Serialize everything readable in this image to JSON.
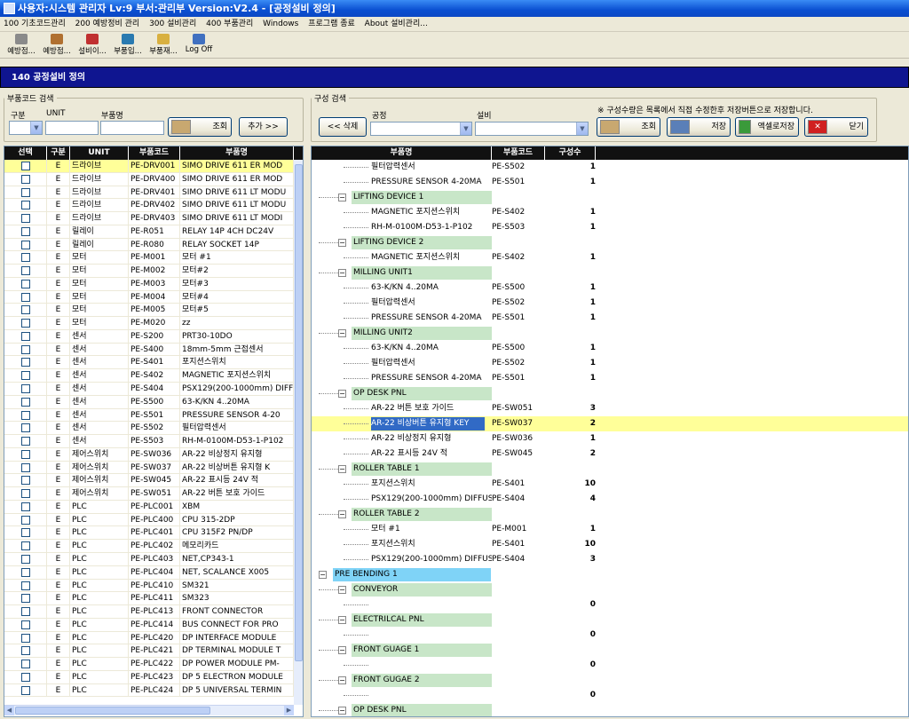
{
  "window": {
    "title": "사용자:시스템 관리자 Lv:9  부서:관리부  Version:V2.4 - [공정설비 정의]"
  },
  "menu": [
    "100 기초코드관리",
    "200 예방정비 관리",
    "300 설비관리",
    "400 부품관리",
    "Windows",
    "프로그램 종료",
    "About 설비관리..."
  ],
  "toolbar": [
    {
      "label": "예방점...",
      "icon": "wrench-icon",
      "color": "#8a8a8a"
    },
    {
      "label": "예방점...",
      "icon": "spray-icon",
      "color": "#b07030"
    },
    {
      "label": "설비이...",
      "icon": "pencil-icon",
      "color": "#c03030"
    },
    {
      "label": "부품입...",
      "icon": "door-in-icon",
      "color": "#2a7ab0"
    },
    {
      "label": "부품재...",
      "icon": "folder-icon",
      "color": "#d8b040"
    },
    {
      "label": "Log Off",
      "icon": "people-icon",
      "color": "#4070c0"
    }
  ],
  "form_title": "140 공정설비 정의",
  "part_search": {
    "legend": "부품코드 검색",
    "labels": [
      "구분",
      "UNIT",
      "부품명"
    ],
    "search_btn": "조회",
    "add_btn": "추가 >>"
  },
  "config_search": {
    "legend": "구성 검색",
    "labels": [
      "공정",
      "설비"
    ],
    "note": "※ 구성수량은 목록에서 직접 수정한후 저장버튼으로 저장합니다.",
    "delete_btn": "<< 삭제",
    "search_btn": "조회",
    "save_btn": "저장",
    "excel_btn": "액셀로저장",
    "close_btn": "닫기"
  },
  "left_grid": {
    "columns": [
      "선택",
      "구분",
      "UNIT",
      "부품코드",
      "부품명"
    ],
    "rows": [
      {
        "type": "E",
        "unit": "드라이브",
        "code": "PE-DRV001",
        "name": "SIMO DRIVE 611 ER MOD",
        "selected": true
      },
      {
        "type": "E",
        "unit": "드라이브",
        "code": "PE-DRV400",
        "name": "SIMO DRIVE 611 ER MOD"
      },
      {
        "type": "E",
        "unit": "드라이브",
        "code": "PE-DRV401",
        "name": "SIMO DRIVE 611 LT MODU"
      },
      {
        "type": "E",
        "unit": "드라이브",
        "code": "PE-DRV402",
        "name": "SIMO DRIVE 611 LT MODU"
      },
      {
        "type": "E",
        "unit": "드라이브",
        "code": "PE-DRV403",
        "name": "SIMO DRIVE 611 LT MODI"
      },
      {
        "type": "E",
        "unit": "릴레이",
        "code": "PE-R051",
        "name": "RELAY 14P 4CH DC24V"
      },
      {
        "type": "E",
        "unit": "릴레이",
        "code": "PE-R080",
        "name": "RELAY SOCKET 14P"
      },
      {
        "type": "E",
        "unit": "모터",
        "code": "PE-M001",
        "name": "모터 #1"
      },
      {
        "type": "E",
        "unit": "모터",
        "code": "PE-M002",
        "name": "모터#2"
      },
      {
        "type": "E",
        "unit": "모터",
        "code": "PE-M003",
        "name": "모터#3"
      },
      {
        "type": "E",
        "unit": "모터",
        "code": "PE-M004",
        "name": "모터#4"
      },
      {
        "type": "E",
        "unit": "모터",
        "code": "PE-M005",
        "name": "모터#5"
      },
      {
        "type": "E",
        "unit": "모터",
        "code": "PE-M020",
        "name": "zz"
      },
      {
        "type": "E",
        "unit": "센서",
        "code": "PE-S200",
        "name": "PRT30-10DO"
      },
      {
        "type": "E",
        "unit": "센서",
        "code": "PE-S400",
        "name": "18mm-5mm 근접센서"
      },
      {
        "type": "E",
        "unit": "센서",
        "code": "PE-S401",
        "name": "포지션스위치"
      },
      {
        "type": "E",
        "unit": "센서",
        "code": "PE-S402",
        "name": "MAGNETIC 포지션스위치"
      },
      {
        "type": "E",
        "unit": "센서",
        "code": "PE-S404",
        "name": "PSX129(200-1000mm) DIFF"
      },
      {
        "type": "E",
        "unit": "센서",
        "code": "PE-S500",
        "name": "63-K/KN 4..20MA"
      },
      {
        "type": "E",
        "unit": "센서",
        "code": "PE-S501",
        "name": "PRESSURE SENSOR 4-20"
      },
      {
        "type": "E",
        "unit": "센서",
        "code": "PE-S502",
        "name": "필터압력센서"
      },
      {
        "type": "E",
        "unit": "센서",
        "code": "PE-S503",
        "name": "RH-M-0100M-D53-1-P102"
      },
      {
        "type": "E",
        "unit": "제어스위치",
        "code": "PE-SW036",
        "name": "AR-22 비상정지 유지형"
      },
      {
        "type": "E",
        "unit": "제어스위치",
        "code": "PE-SW037",
        "name": "AR-22 비상버튼 유지형 K"
      },
      {
        "type": "E",
        "unit": "제어스위치",
        "code": "PE-SW045",
        "name": "AR-22 표시등 24V 적"
      },
      {
        "type": "E",
        "unit": "제어스위치",
        "code": "PE-SW051",
        "name": "AR-22 버튼 보호 가이드"
      },
      {
        "type": "E",
        "unit": "PLC",
        "code": "PE-PLC001",
        "name": "XBM"
      },
      {
        "type": "E",
        "unit": "PLC",
        "code": "PE-PLC400",
        "name": "CPU 315-2DP"
      },
      {
        "type": "E",
        "unit": "PLC",
        "code": "PE-PLC401",
        "name": "CPU 315F2 PN/DP"
      },
      {
        "type": "E",
        "unit": "PLC",
        "code": "PE-PLC402",
        "name": "메모리카드"
      },
      {
        "type": "E",
        "unit": "PLC",
        "code": "PE-PLC403",
        "name": "NET,CP343-1"
      },
      {
        "type": "E",
        "unit": "PLC",
        "code": "PE-PLC404",
        "name": "NET, SCALANCE X005"
      },
      {
        "type": "E",
        "unit": "PLC",
        "code": "PE-PLC410",
        "name": "SM321"
      },
      {
        "type": "E",
        "unit": "PLC",
        "code": "PE-PLC411",
        "name": "SM323"
      },
      {
        "type": "E",
        "unit": "PLC",
        "code": "PE-PLC413",
        "name": "FRONT CONNECTOR"
      },
      {
        "type": "E",
        "unit": "PLC",
        "code": "PE-PLC414",
        "name": "BUS CONNECT FOR PRO"
      },
      {
        "type": "E",
        "unit": "PLC",
        "code": "PE-PLC420",
        "name": "DP INTERFACE MODULE"
      },
      {
        "type": "E",
        "unit": "PLC",
        "code": "PE-PLC421",
        "name": "DP TERMINAL MODULE T"
      },
      {
        "type": "E",
        "unit": "PLC",
        "code": "PE-PLC422",
        "name": "DP POWER MODULE PM-"
      },
      {
        "type": "E",
        "unit": "PLC",
        "code": "PE-PLC423",
        "name": "DP 5 ELECTRON MODULE"
      },
      {
        "type": "E",
        "unit": "PLC",
        "code": "PE-PLC424",
        "name": "DP 5 UNIVERSAL TERMIN"
      }
    ]
  },
  "right_grid": {
    "columns": [
      "부품명",
      "부품코드",
      "구성수"
    ],
    "rows": [
      {
        "level": 2,
        "name": "필터압력센서",
        "code": "PE-S502",
        "qty": "1"
      },
      {
        "level": 2,
        "name": "PRESSURE SENSOR 4-20MA",
        "code": "PE-S501",
        "qty": "1"
      },
      {
        "level": 1,
        "name": "LIFTING DEVICE 1",
        "code": "",
        "qty": ""
      },
      {
        "level": 2,
        "name": "MAGNETIC 포지션스위치",
        "code": "PE-S402",
        "qty": "1"
      },
      {
        "level": 2,
        "name": "RH-M-0100M-D53-1-P102",
        "code": "PE-S503",
        "qty": "1"
      },
      {
        "level": 1,
        "name": "LIFTING DEVICE 2",
        "code": "",
        "qty": ""
      },
      {
        "level": 2,
        "name": "MAGNETIC 포지션스위치",
        "code": "PE-S402",
        "qty": "1"
      },
      {
        "level": 1,
        "name": "MILLING UNIT1",
        "code": "",
        "qty": ""
      },
      {
        "level": 2,
        "name": "63-K/KN 4..20MA",
        "code": "PE-S500",
        "qty": "1"
      },
      {
        "level": 2,
        "name": "필터압력센서",
        "code": "PE-S502",
        "qty": "1"
      },
      {
        "level": 2,
        "name": "PRESSURE SENSOR 4-20MA",
        "code": "PE-S501",
        "qty": "1"
      },
      {
        "level": 1,
        "name": "MILLING UNIT2",
        "code": "",
        "qty": ""
      },
      {
        "level": 2,
        "name": "63-K/KN 4..20MA",
        "code": "PE-S500",
        "qty": "1"
      },
      {
        "level": 2,
        "name": "필터압력센서",
        "code": "PE-S502",
        "qty": "1"
      },
      {
        "level": 2,
        "name": "PRESSURE SENSOR 4-20MA",
        "code": "PE-S501",
        "qty": "1"
      },
      {
        "level": 1,
        "name": "OP DESK PNL",
        "code": "",
        "qty": ""
      },
      {
        "level": 2,
        "name": "AR-22 버튼 보호 가이드",
        "code": "PE-SW051",
        "qty": "3"
      },
      {
        "level": 2,
        "name": "AR-22 비상버튼 유지형 KEY",
        "code": "PE-SW037",
        "qty": "2",
        "selected": true
      },
      {
        "level": 2,
        "name": "AR-22 비상정지 유지형",
        "code": "PE-SW036",
        "qty": "1"
      },
      {
        "level": 2,
        "name": "AR-22 표시등 24V 적",
        "code": "PE-SW045",
        "qty": "2"
      },
      {
        "level": 1,
        "name": "ROLLER TABLE 1",
        "code": "",
        "qty": ""
      },
      {
        "level": 2,
        "name": "포지션스위치",
        "code": "PE-S401",
        "qty": "10"
      },
      {
        "level": 2,
        "name": "PSX129(200-1000mm) DIFFUSE",
        "code": "PE-S404",
        "qty": "4"
      },
      {
        "level": 1,
        "name": "ROLLER TABLE 2",
        "code": "",
        "qty": ""
      },
      {
        "level": 2,
        "name": "모터 #1",
        "code": "PE-M001",
        "qty": "1"
      },
      {
        "level": 2,
        "name": "포지션스위치",
        "code": "PE-S401",
        "qty": "10"
      },
      {
        "level": 2,
        "name": "PSX129(200-1000mm) DIFFUSE",
        "code": "PE-S404",
        "qty": "3"
      },
      {
        "level": 0,
        "name": "PRE BENDING 1",
        "code": "",
        "qty": ""
      },
      {
        "level": 1,
        "name": "CONVEYOR",
        "code": "",
        "qty": ""
      },
      {
        "level": 2,
        "name": "",
        "code": "",
        "qty": "0"
      },
      {
        "level": 1,
        "name": "ELECTRILCAL PNL",
        "code": "",
        "qty": ""
      },
      {
        "level": 2,
        "name": "",
        "code": "",
        "qty": "0"
      },
      {
        "level": 1,
        "name": "FRONT GUAGE 1",
        "code": "",
        "qty": ""
      },
      {
        "level": 2,
        "name": "",
        "code": "",
        "qty": "0"
      },
      {
        "level": 1,
        "name": "FRONT GUGAE 2",
        "code": "",
        "qty": ""
      },
      {
        "level": 2,
        "name": "",
        "code": "",
        "qty": "0"
      },
      {
        "level": 1,
        "name": "OP DESK PNL",
        "code": "",
        "qty": ""
      }
    ]
  }
}
